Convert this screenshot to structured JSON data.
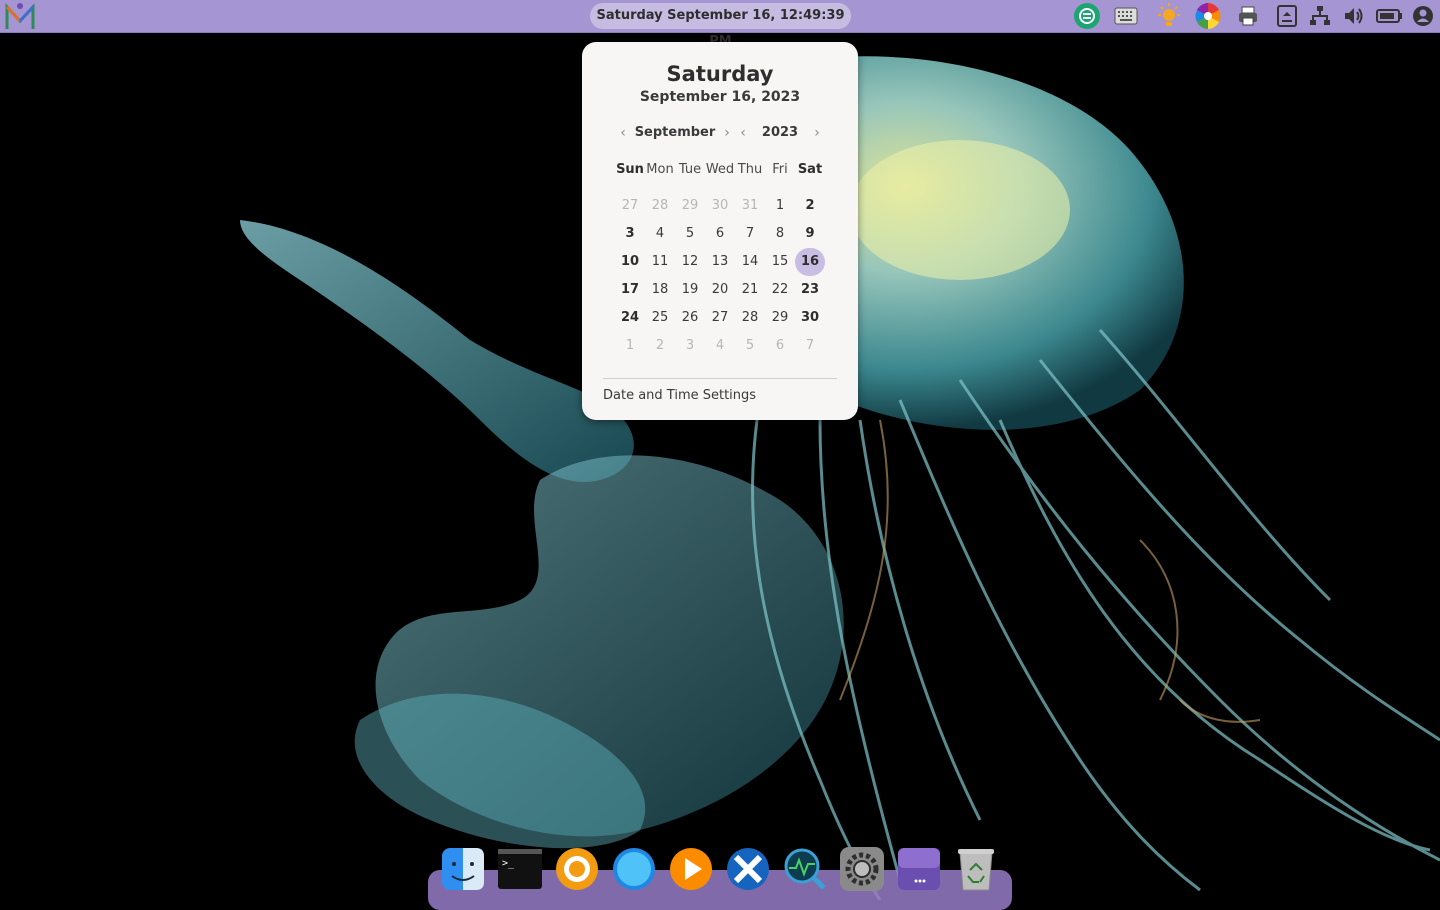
{
  "top_panel": {
    "clock_text": "Saturday September 16, 12:49:39 PM",
    "tray_icons": [
      "sync-icon",
      "keyboard-icon",
      "brightness-icon",
      "color-wheel-icon",
      "printer-icon",
      "upload-icon",
      "network-icon",
      "volume-icon",
      "battery-icon",
      "user-icon"
    ]
  },
  "calendar": {
    "weekday_title": "Saturday",
    "date_subtitle": "September 16, 2023",
    "month_label": "September",
    "year_label": "2023",
    "prev_month_arrow": "‹",
    "next_month_arrow": "›",
    "prev_year_arrow": "‹",
    "next_year_arrow": "›",
    "day_headers": [
      "Sun",
      "Mon",
      "Tue",
      "Wed",
      "Thu",
      "Fri",
      "Sat"
    ],
    "weeks": [
      [
        "27",
        "28",
        "29",
        "30",
        "31",
        "1",
        "2"
      ],
      [
        "3",
        "4",
        "5",
        "6",
        "7",
        "8",
        "9"
      ],
      [
        "10",
        "11",
        "12",
        "13",
        "14",
        "15",
        "16"
      ],
      [
        "17",
        "18",
        "19",
        "20",
        "21",
        "22",
        "23"
      ],
      [
        "24",
        "25",
        "26",
        "27",
        "28",
        "29",
        "30"
      ],
      [
        "1",
        "2",
        "3",
        "4",
        "5",
        "6",
        "7"
      ]
    ],
    "today": "16",
    "settings_link": "Date and Time Settings",
    "highlight_color": "#c8bde2"
  },
  "dock": {
    "items": [
      "finder-icon",
      "terminal-icon",
      "software-center-icon",
      "browser-icon",
      "media-player-icon",
      "crossover-icon",
      "system-monitor-icon",
      "settings-icon",
      "window-manager-icon",
      "trash-icon"
    ],
    "panel_color": "#a695d3"
  }
}
